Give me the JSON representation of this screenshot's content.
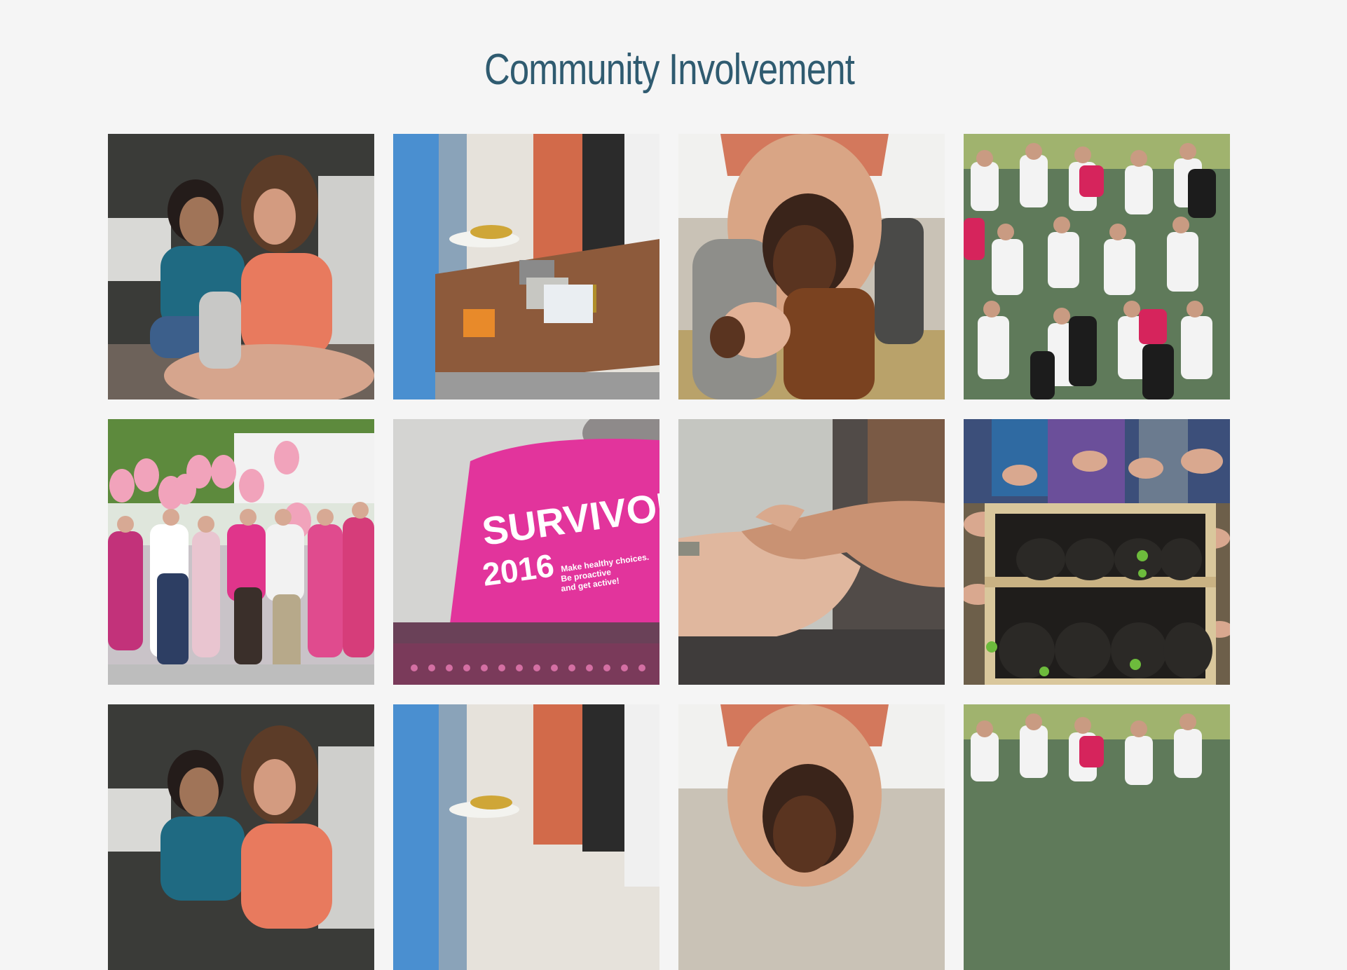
{
  "section": {
    "title": "Community Involvement",
    "title_color": "#2f5b70"
  },
  "gallery": {
    "tiles": [
      {
        "name": "photo-mother-and-daughter",
        "icon": "photo-icon"
      },
      {
        "name": "photo-food-serving-line",
        "icon": "photo-icon"
      },
      {
        "name": "photo-woman-holding-child",
        "icon": "photo-icon"
      },
      {
        "name": "photo-race-runners-crowd",
        "icon": "photo-icon"
      },
      {
        "name": "photo-pink-balloons-crowd",
        "icon": "photo-icon"
      },
      {
        "name": "photo-survivor-2016-shirt",
        "icon": "photo-icon",
        "shirt_text": [
          "SURVIVOR",
          "2016"
        ],
        "shirt_subtext": [
          "Make healthy choices.",
          "Be proactive",
          "and get active!"
        ]
      },
      {
        "name": "photo-holding-hands",
        "icon": "photo-icon"
      },
      {
        "name": "photo-garden-planter-hands",
        "icon": "photo-icon"
      },
      {
        "name": "photo-mother-and-daughter",
        "icon": "photo-icon"
      },
      {
        "name": "photo-food-serving-line",
        "icon": "photo-icon"
      },
      {
        "name": "photo-woman-holding-child",
        "icon": "photo-icon"
      },
      {
        "name": "photo-race-runners-crowd",
        "icon": "photo-icon"
      }
    ]
  }
}
